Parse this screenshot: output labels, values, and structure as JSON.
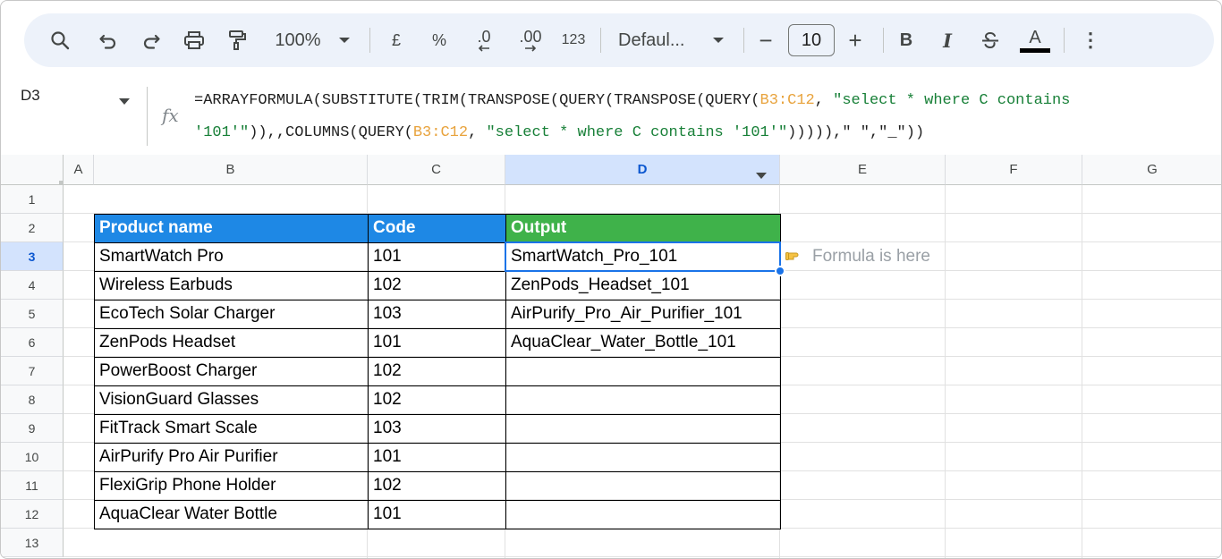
{
  "toolbar": {
    "zoom": "100%",
    "currency": "£",
    "percent": "%",
    "dec_decrease": ".0",
    "dec_increase": ".00",
    "number_format": "123",
    "font": "Defaul...",
    "minus": "−",
    "font_size": "10",
    "plus": "+",
    "bold": "B",
    "italic": "I",
    "text_color": "A",
    "more": "⋮"
  },
  "formula_bar": {
    "name_box": "D3",
    "fx": "fx",
    "formula": {
      "p1": "=ARRAYFORMULA(SUBSTITUTE(TRIM(TRANSPOSE(QUERY(TRANSPOSE(QUERY(",
      "r1": "B3:C12",
      "p2": ", ",
      "s1": "\"select * where C contains '101'\"",
      "p3": ")),,COLUMNS(QUERY(",
      "r2": "B3:C12",
      "p4": ", ",
      "s2": "\"select * where C contains '101'\"",
      "p5": "))))),\" \",\"_\"))"
    }
  },
  "grid": {
    "columns": [
      "A",
      "B",
      "C",
      "D",
      "E",
      "F",
      "G"
    ],
    "selected_column": "D",
    "rows": [
      "1",
      "2",
      "3",
      "4",
      "5",
      "6",
      "7",
      "8",
      "9",
      "10",
      "11",
      "12",
      "13"
    ],
    "selected_row": "3",
    "headers": {
      "product": "Product name",
      "code": "Code",
      "output": "Output"
    },
    "products": [
      {
        "name": "SmartWatch Pro",
        "code": "101"
      },
      {
        "name": "Wireless Earbuds",
        "code": "102"
      },
      {
        "name": "EcoTech Solar Charger",
        "code": "103"
      },
      {
        "name": "ZenPods Headset",
        "code": "101"
      },
      {
        "name": "PowerBoost Charger",
        "code": "102"
      },
      {
        "name": "VisionGuard Glasses",
        "code": "102"
      },
      {
        "name": "FitTrack Smart Scale",
        "code": "103"
      },
      {
        "name": "AirPurify Pro Air Purifier",
        "code": "101"
      },
      {
        "name": "FlexiGrip Phone Holder",
        "code": "102"
      },
      {
        "name": "AquaClear Water Bottle",
        "code": "101"
      }
    ],
    "outputs": [
      "SmartWatch_Pro_101",
      "ZenPods_Headset_101",
      "AirPurify_Pro_Air_Purifier_101",
      "AquaClear_Water_Bottle_101",
      "",
      "",
      "",
      "",
      "",
      ""
    ],
    "note": "Formula is here"
  },
  "colors": {
    "header_blue": "#1e88e5",
    "header_green": "#3fb24a",
    "selection": "#1a73e8",
    "formula_range": "#e8a33d",
    "formula_string": "#188038"
  }
}
